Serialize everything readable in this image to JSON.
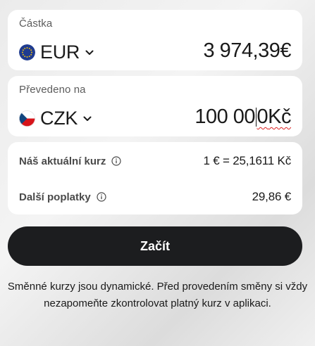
{
  "amount": {
    "label": "Částka",
    "currency": "EUR",
    "value": "3 974,39€",
    "flag_icon": "eu-flag-icon"
  },
  "converted": {
    "label": "Převedeno na",
    "currency": "CZK",
    "value_before_caret": "100 00",
    "value_after_caret": "0",
    "value_suffix": "Kč",
    "flag_icon": "cz-flag-icon"
  },
  "rate": {
    "label": "Náš aktuální kurz",
    "value": "1 € = 25,1611 Kč"
  },
  "fees": {
    "label": "Další poplatky",
    "value": "29,86 €"
  },
  "cta": {
    "label": "Začít"
  },
  "disclaimer": "Směnné kurzy jsou dynamické. Před provedením směny si vždy nezapomeňte zkontrolovat platný kurz v aplikaci.",
  "colors": {
    "button_bg": "#1c1d1f",
    "eu_blue": "#1f3b8f",
    "eu_gold": "#f4c20d",
    "cz_red": "#d7141a",
    "cz_blue": "#11457e",
    "spellcheck": "#dd2222"
  }
}
